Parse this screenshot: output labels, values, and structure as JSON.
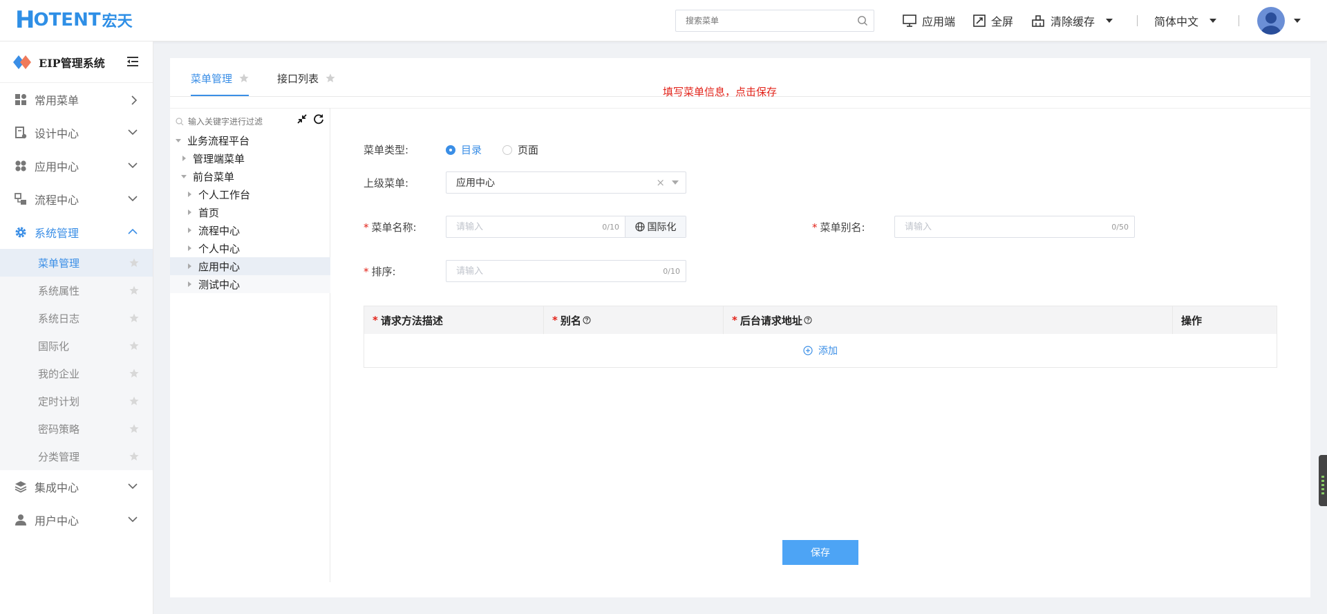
{
  "header": {
    "logo_mark": "H",
    "logo_text": "OTENT",
    "logo_cn": "宏天",
    "search_placeholder": "搜索菜单",
    "app_end_label": "应用端",
    "fullscreen_label": "全屏",
    "clear_cache_label": "清除缓存",
    "language_label": "简体中文"
  },
  "sidebar": {
    "system_title": "EIP管理系统",
    "menus": [
      {
        "label": "常用菜单",
        "icon": "dashboard-icon"
      },
      {
        "label": "设计中心",
        "icon": "design-icon"
      },
      {
        "label": "应用中心",
        "icon": "apps-icon"
      },
      {
        "label": "流程中心",
        "icon": "flow-icon"
      },
      {
        "label": "系统管理",
        "icon": "gear-icon"
      },
      {
        "label": "集成中心",
        "icon": "layers-icon"
      },
      {
        "label": "用户中心",
        "icon": "user-icon"
      }
    ],
    "system_submenu": [
      {
        "label": "菜单管理"
      },
      {
        "label": "系统属性"
      },
      {
        "label": "系统日志"
      },
      {
        "label": "国际化"
      },
      {
        "label": "我的企业"
      },
      {
        "label": "定时计划"
      },
      {
        "label": "密码策略"
      },
      {
        "label": "分类管理"
      }
    ]
  },
  "tabs": [
    {
      "label": "菜单管理"
    },
    {
      "label": "接口列表"
    }
  ],
  "hint_text": "填写菜单信息，点击保存",
  "tree": {
    "search_placeholder": "输入关键字进行过滤",
    "nodes": [
      {
        "label": "业务流程平台"
      },
      {
        "label": "管理端菜单"
      },
      {
        "label": "前台菜单"
      },
      {
        "label": "个人工作台"
      },
      {
        "label": "首页"
      },
      {
        "label": "流程中心"
      },
      {
        "label": "个人中心"
      },
      {
        "label": "应用中心"
      },
      {
        "label": "测试中心"
      }
    ]
  },
  "form": {
    "menu_type_label": "菜单类型:",
    "menu_type_options": [
      "目录",
      "页面"
    ],
    "menu_type_selected": "目录",
    "parent_menu_label": "上级菜单:",
    "parent_menu_value": "应用中心",
    "menu_name_label": "菜单名称:",
    "menu_name_placeholder": "请输入",
    "menu_name_count": "0/10",
    "i18n_button": "国际化",
    "menu_alias_label": "菜单别名:",
    "menu_alias_placeholder": "请输入",
    "menu_alias_count": "0/50",
    "sort_label": "排序:",
    "sort_placeholder": "请输入",
    "sort_count": "0/10"
  },
  "table": {
    "headers": [
      "请求方法描述",
      "别名",
      "后台请求地址",
      "操作"
    ],
    "add_label": "添加"
  },
  "save_label": "保存",
  "colors": {
    "primary": "#3a8ee6",
    "hint": "#e2231a"
  }
}
